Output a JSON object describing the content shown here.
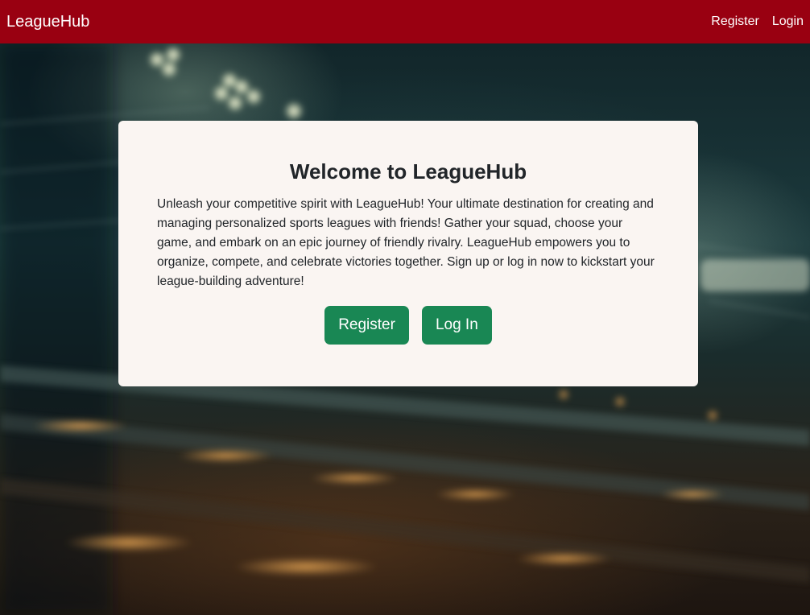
{
  "navbar": {
    "brand": "LeagueHub",
    "links": [
      {
        "label": "Register"
      },
      {
        "label": "Login"
      }
    ],
    "background_color": "#990011"
  },
  "hero": {
    "title": "Welcome to LeagueHub",
    "description": "Unleash your competitive spirit with LeagueHub! Your ultimate destination for creating and managing personalized sports leagues with friends! Gather your squad, choose your game, and embark on an epic journey of friendly rivalry. LeagueHub empowers you to organize, compete, and celebrate victories together. Sign up or log in now to kickstart your league-building adventure!",
    "buttons": {
      "register_label": "Register",
      "login_label": "Log In"
    },
    "button_color": "#198754",
    "card_color": "#faf5f2",
    "background_image": "blurred-stadium-at-night"
  }
}
